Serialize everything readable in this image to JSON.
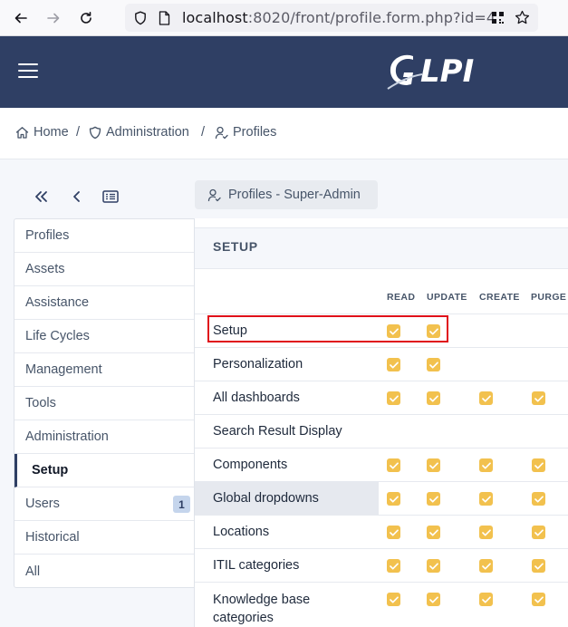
{
  "browser": {
    "url_host": "localhost",
    "url_rest": ":8020/front/profile.form.php?id=4"
  },
  "header": {
    "logo_text": "GLPI"
  },
  "breadcrumb": {
    "items": [
      {
        "label": "Home",
        "icon": "home-icon"
      },
      {
        "label": "Administration",
        "icon": "shield-icon"
      },
      {
        "label": "Profiles",
        "icon": "user-check-icon"
      }
    ],
    "separator": "/"
  },
  "item": {
    "title": "Profiles - Super-Admin",
    "icon": "user-check-icon"
  },
  "tabs": [
    {
      "label": "Profiles",
      "active": false
    },
    {
      "label": "Assets",
      "active": false
    },
    {
      "label": "Assistance",
      "active": false
    },
    {
      "label": "Life Cycles",
      "active": false
    },
    {
      "label": "Management",
      "active": false
    },
    {
      "label": "Tools",
      "active": false
    },
    {
      "label": "Administration",
      "active": false
    },
    {
      "label": "Setup",
      "active": true
    },
    {
      "label": "Users",
      "active": false,
      "badge": "1"
    },
    {
      "label": "Historical",
      "active": false
    },
    {
      "label": "All",
      "active": false
    }
  ],
  "setup": {
    "section_title": "SETUP",
    "columns": [
      "READ",
      "UPDATE",
      "CREATE",
      "PURGE"
    ],
    "rows": [
      {
        "label": "Setup",
        "rights": [
          true,
          true,
          null,
          null
        ],
        "highlighted": false
      },
      {
        "label": "Personalization",
        "rights": [
          true,
          true,
          null,
          null
        ],
        "highlighted": false
      },
      {
        "label": "All dashboards",
        "rights": [
          true,
          true,
          true,
          true
        ],
        "highlighted": false
      },
      {
        "label": "Search Result Display",
        "rights": [
          null,
          null,
          null,
          null
        ],
        "highlighted": false
      },
      {
        "label": "Components",
        "rights": [
          true,
          true,
          true,
          true
        ],
        "highlighted": false
      },
      {
        "label": "Global dropdowns",
        "rights": [
          true,
          true,
          true,
          true
        ],
        "highlighted": true
      },
      {
        "label": "Locations",
        "rights": [
          true,
          true,
          true,
          true
        ],
        "highlighted": false
      },
      {
        "label": "ITIL categories",
        "rights": [
          true,
          true,
          true,
          true
        ],
        "highlighted": false
      },
      {
        "label": "Knowledge base categories",
        "rights": [
          true,
          true,
          true,
          true
        ],
        "highlighted": false
      }
    ]
  },
  "colors": {
    "header_bg": "#2f3f64",
    "checkbox": "#f2c14e",
    "highlight_box": "#e0101a"
  }
}
